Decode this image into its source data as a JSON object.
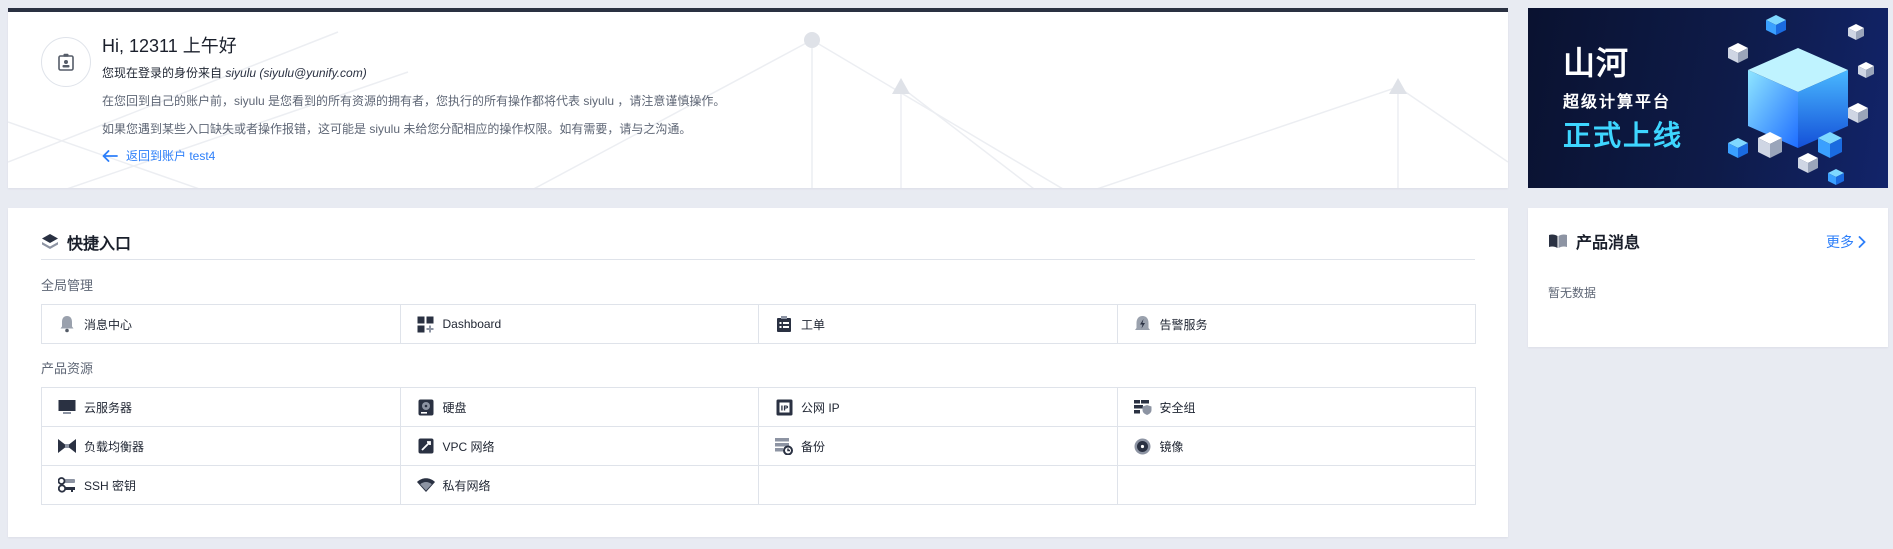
{
  "welcome": {
    "greeting": "Hi, 12311 上午好",
    "identity_prefix": "您现在登录的身份来自",
    "identity_user": "siyulu (siyulu@yunify.com)",
    "tip_line1": "在您回到自己的账户前，siyulu 是您看到的所有资源的拥有者，您执行的所有操作都将代表 siyulu ，请注意谨慎操作。",
    "tip_line2": "如果您遇到某些入口缺失或者操作报错，这可能是 siyulu 未给您分配相应的操作权限。如有需要，请与之沟通。",
    "back_link": "返回到账户 test4"
  },
  "banner": {
    "logo": "山河",
    "subtitle": "超级计算平台",
    "headline": "正式上线"
  },
  "quick_entry": {
    "title": "快捷入口",
    "groups": [
      {
        "label": "全局管理",
        "items": [
          {
            "label": "消息中心",
            "icon": "bell-icon"
          },
          {
            "label": "Dashboard",
            "icon": "dashboard-icon"
          },
          {
            "label": "工单",
            "icon": "ticket-icon"
          },
          {
            "label": "告警服务",
            "icon": "alarm-icon"
          }
        ]
      },
      {
        "label": "产品资源",
        "items": [
          {
            "label": "云服务器",
            "icon": "monitor-icon"
          },
          {
            "label": "硬盘",
            "icon": "disk-icon"
          },
          {
            "label": "公网 IP",
            "icon": "ip-icon"
          },
          {
            "label": "安全组",
            "icon": "firewall-icon"
          },
          {
            "label": "负载均衡器",
            "icon": "load-balancer-icon"
          },
          {
            "label": "VPC 网络",
            "icon": "vpc-icon"
          },
          {
            "label": "备份",
            "icon": "backup-icon"
          },
          {
            "label": "镜像",
            "icon": "image-disc-icon"
          },
          {
            "label": "SSH 密钥",
            "icon": "key-icon"
          },
          {
            "label": "私有网络",
            "icon": "wifi-icon"
          }
        ]
      }
    ]
  },
  "news": {
    "title": "产品消息",
    "more": "更多",
    "empty": "暂无数据"
  },
  "colors": {
    "accent": "#2d7ff9",
    "dark": "#2a3142",
    "background": "#e8ebf2"
  }
}
